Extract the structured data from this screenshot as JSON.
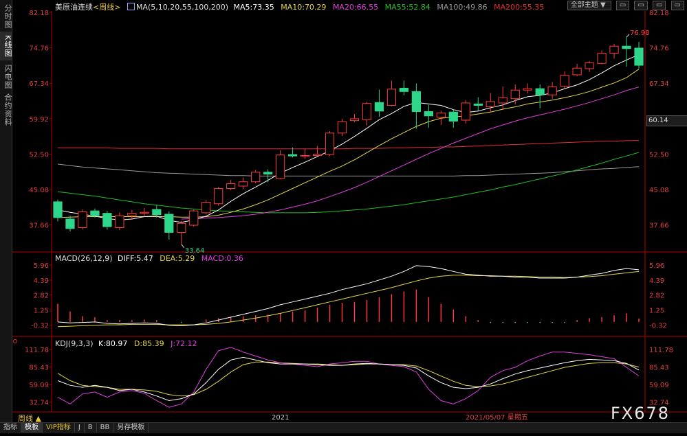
{
  "leftbar": [
    {
      "label": "分时图",
      "active": false
    },
    {
      "label": "K线图",
      "active": true
    },
    {
      "label": "闪电图",
      "active": false
    },
    {
      "label": "合约资料",
      "active": false
    }
  ],
  "header": {
    "instrument": "美原油连续",
    "period_tag": "<周线>",
    "ma_label": "MA(5,10,20,55,100,200)",
    "ma5": "MA5:73.35",
    "ma10": "MA10:70.29",
    "ma20": "MA20:66.55",
    "ma55": "MA55:52.84",
    "ma100": "MA100:49.86",
    "ma200": "MA200:55.35"
  },
  "toolbar": {
    "theme_select": "全部主题",
    "theme_arrow": "▼",
    "btn1": "▭",
    "btn2": "▭",
    "btn3": "▭",
    "btn4": "▭"
  },
  "colors": {
    "up": "#ff3c3c",
    "down": "#2ed68a",
    "ma5": "#ffffff",
    "ma10": "#e8d84a",
    "ma20": "#e040e0",
    "ma55": "#22c022",
    "ma100": "#9a9a9a",
    "ma200": "#e03030",
    "axis": "#b40000"
  },
  "chart_data": [
    {
      "type": "candlestick",
      "title": "美原油连续<周线>",
      "ylim": [
        33.0,
        82.18
      ],
      "y_ticks": [
        "82.18",
        "74.76",
        "67.34",
        "59.92",
        "52.50",
        "45.08",
        "37.66"
      ],
      "annotations": {
        "high": "76.98",
        "low": "33.64",
        "current_price": "60.14"
      },
      "candles": [
        {
          "o": 42.5,
          "h": 43.0,
          "c": 39.2,
          "l": 38.4
        },
        {
          "o": 38.9,
          "h": 39.6,
          "c": 36.9,
          "l": 36.3
        },
        {
          "o": 37.1,
          "h": 40.9,
          "c": 40.4,
          "l": 36.7
        },
        {
          "o": 40.6,
          "h": 41.1,
          "c": 39.6,
          "l": 39.2
        },
        {
          "o": 40.1,
          "h": 40.6,
          "c": 37.3,
          "l": 36.7
        },
        {
          "o": 37.1,
          "h": 40.3,
          "c": 39.6,
          "l": 36.6
        },
        {
          "o": 39.6,
          "h": 40.8,
          "c": 40.1,
          "l": 38.9
        },
        {
          "o": 40.1,
          "h": 41.2,
          "c": 40.3,
          "l": 39.5
        },
        {
          "o": 40.9,
          "h": 41.9,
          "c": 39.8,
          "l": 39.2
        },
        {
          "o": 39.9,
          "h": 40.5,
          "c": 36.1,
          "l": 34.6
        },
        {
          "o": 36.1,
          "h": 38.5,
          "c": 38.0,
          "l": 33.6
        },
        {
          "o": 37.6,
          "h": 40.9,
          "c": 40.6,
          "l": 37.3
        },
        {
          "o": 40.2,
          "h": 42.9,
          "c": 42.4,
          "l": 39.9
        },
        {
          "o": 42.1,
          "h": 45.6,
          "c": 45.3,
          "l": 41.7
        },
        {
          "o": 45.3,
          "h": 47.1,
          "c": 46.3,
          "l": 44.9
        },
        {
          "o": 45.8,
          "h": 47.6,
          "c": 46.7,
          "l": 45.2
        },
        {
          "o": 46.7,
          "h": 49.2,
          "c": 48.7,
          "l": 46.4
        },
        {
          "o": 48.7,
          "h": 49.3,
          "c": 48.3,
          "l": 46.6
        },
        {
          "o": 47.4,
          "h": 53.3,
          "c": 52.3,
          "l": 47.2
        },
        {
          "o": 52.4,
          "h": 53.9,
          "c": 52.1,
          "l": 51.8
        },
        {
          "o": 52.0,
          "h": 53.6,
          "c": 52.2,
          "l": 51.5
        },
        {
          "o": 52.2,
          "h": 54.2,
          "c": 52.5,
          "l": 52.0
        },
        {
          "o": 52.4,
          "h": 57.3,
          "c": 56.9,
          "l": 52.1
        },
        {
          "o": 56.9,
          "h": 59.9,
          "c": 59.3,
          "l": 56.3
        },
        {
          "o": 59.5,
          "h": 60.9,
          "c": 59.9,
          "l": 59.2
        },
        {
          "o": 59.7,
          "h": 63.4,
          "c": 63.1,
          "l": 58.5
        },
        {
          "o": 63.3,
          "h": 66.0,
          "c": 61.5,
          "l": 60.3
        },
        {
          "o": 62.7,
          "h": 67.9,
          "c": 66.1,
          "l": 62.5
        },
        {
          "o": 66.3,
          "h": 67.9,
          "c": 65.6,
          "l": 64.8
        },
        {
          "o": 65.6,
          "h": 67.3,
          "c": 61.4,
          "l": 57.8
        },
        {
          "o": 61.4,
          "h": 62.8,
          "c": 60.5,
          "l": 58.0
        },
        {
          "o": 60.2,
          "h": 61.6,
          "c": 61.1,
          "l": 58.6
        },
        {
          "o": 61.3,
          "h": 61.9,
          "c": 59.4,
          "l": 58.0
        },
        {
          "o": 59.6,
          "h": 63.8,
          "c": 63.2,
          "l": 58.9
        },
        {
          "o": 63.0,
          "h": 64.4,
          "c": 62.7,
          "l": 61.6
        },
        {
          "o": 62.4,
          "h": 65.3,
          "c": 63.5,
          "l": 61.2
        },
        {
          "o": 63.2,
          "h": 66.7,
          "c": 64.3,
          "l": 61.9
        },
        {
          "o": 64.1,
          "h": 67.1,
          "c": 65.9,
          "l": 62.9
        },
        {
          "o": 65.9,
          "h": 67.3,
          "c": 66.2,
          "l": 65.2
        },
        {
          "o": 66.2,
          "h": 67.1,
          "c": 64.9,
          "l": 62.1
        },
        {
          "o": 64.9,
          "h": 67.6,
          "c": 66.6,
          "l": 64.1
        },
        {
          "o": 66.7,
          "h": 69.8,
          "c": 69.0,
          "l": 66.2
        },
        {
          "o": 69.1,
          "h": 71.4,
          "c": 70.5,
          "l": 68.8
        },
        {
          "o": 70.4,
          "h": 72.0,
          "c": 71.6,
          "l": 69.7
        },
        {
          "o": 71.5,
          "h": 74.2,
          "c": 73.6,
          "l": 71.3
        },
        {
          "o": 73.6,
          "h": 75.6,
          "c": 75.1,
          "l": 72.5
        },
        {
          "o": 75.1,
          "h": 77.0,
          "c": 74.6,
          "l": 70.8
        },
        {
          "o": 74.7,
          "h": 76.0,
          "c": 71.1,
          "l": 70.4
        }
      ],
      "ma5": [
        40.8,
        40.3,
        39.9,
        39.5,
        39.0,
        38.7,
        38.9,
        39.4,
        39.5,
        38.6,
        38.2,
        38.7,
        39.5,
        40.8,
        42.6,
        44.2,
        45.6,
        47.0,
        48.5,
        49.7,
        50.8,
        52.0,
        53.2,
        54.6,
        56.2,
        57.9,
        59.7,
        61.0,
        62.5,
        63.3,
        63.0,
        62.7,
        61.8,
        61.2,
        61.5,
        62.2,
        62.8,
        63.7,
        64.5,
        64.8,
        65.3,
        66.2,
        67.0,
        68.1,
        69.5,
        71.0,
        72.2,
        73.35
      ],
      "ma10": [
        39.2,
        39.3,
        39.4,
        39.4,
        39.4,
        39.4,
        39.4,
        39.4,
        39.4,
        39.4,
        39.3,
        39.3,
        39.4,
        39.7,
        40.3,
        41.0,
        41.9,
        42.9,
        44.1,
        45.3,
        46.5,
        47.7,
        48.9,
        50.0,
        51.3,
        52.8,
        54.3,
        55.7,
        57.0,
        58.3,
        59.3,
        60.0,
        60.3,
        60.5,
        60.9,
        61.3,
        61.9,
        62.4,
        63.0,
        63.4,
        63.8,
        64.3,
        64.9,
        65.6,
        66.5,
        67.4,
        68.5,
        70.29
      ],
      "ma20": [
        null,
        null,
        null,
        null,
        null,
        null,
        null,
        null,
        null,
        null,
        38.9,
        39.0,
        39.1,
        39.2,
        39.4,
        39.6,
        39.9,
        40.3,
        40.8,
        41.4,
        42.0,
        42.7,
        43.6,
        44.5,
        45.5,
        46.6,
        47.8,
        49.0,
        50.2,
        51.4,
        52.6,
        53.7,
        54.8,
        55.8,
        56.8,
        57.8,
        58.6,
        59.4,
        60.1,
        60.7,
        61.3,
        61.9,
        62.6,
        63.3,
        64.1,
        64.9,
        65.8,
        66.55
      ],
      "ma55": [
        44.6,
        44.3,
        44.0,
        43.7,
        43.3,
        42.9,
        42.5,
        42.1,
        41.8,
        41.5,
        41.2,
        41.0,
        40.8,
        40.6,
        40.5,
        40.4,
        40.3,
        40.2,
        40.2,
        40.2,
        40.2,
        40.3,
        40.4,
        40.6,
        40.8,
        41.0,
        41.3,
        41.6,
        41.9,
        42.3,
        42.7,
        43.1,
        43.5,
        44.0,
        44.5,
        45.0,
        45.6,
        46.1,
        46.7,
        47.3,
        47.9,
        48.5,
        49.2,
        49.9,
        50.6,
        51.4,
        52.1,
        52.84
      ],
      "ma100": [
        50.4,
        50.1,
        49.8,
        49.6,
        49.4,
        49.2,
        49.0,
        48.8,
        48.6,
        48.5,
        48.4,
        48.3,
        48.2,
        48.1,
        48.0,
        48.0,
        47.9,
        47.9,
        47.9,
        47.9,
        47.9,
        47.9,
        47.9,
        47.9,
        47.9,
        47.9,
        47.9,
        47.9,
        47.9,
        47.9,
        47.9,
        47.9,
        47.9,
        48.0,
        48.0,
        48.1,
        48.2,
        48.3,
        48.4,
        48.5,
        48.6,
        48.8,
        49.0,
        49.2,
        49.4,
        49.5,
        49.7,
        49.86
      ],
      "ma200": [
        53.8,
        53.8,
        53.8,
        53.8,
        53.8,
        53.7,
        53.7,
        53.7,
        53.7,
        53.6,
        53.6,
        53.6,
        53.6,
        53.6,
        53.6,
        53.6,
        53.6,
        53.6,
        53.6,
        53.6,
        53.6,
        53.6,
        53.6,
        53.6,
        53.7,
        53.7,
        53.7,
        53.8,
        53.8,
        53.9,
        53.9,
        54.0,
        54.0,
        54.1,
        54.2,
        54.3,
        54.4,
        54.5,
        54.6,
        54.7,
        54.8,
        54.9,
        55.0,
        55.1,
        55.2,
        55.2,
        55.3,
        55.35
      ]
    },
    {
      "type": "macd",
      "legend": {
        "label": "MACD(26,12,9)",
        "diff": "DIFF:5.47",
        "dea": "DEA:5.29",
        "macd": "MACD:0.36"
      },
      "ylim": [
        -0.8,
        6.4
      ],
      "y_ticks": [
        "5.96",
        "4.39",
        "2.82",
        "1.25",
        "-0.32"
      ],
      "diff": [
        0.0,
        -0.1,
        -0.05,
        0.0,
        -0.15,
        -0.2,
        -0.15,
        -0.1,
        -0.15,
        -0.35,
        -0.4,
        -0.3,
        -0.1,
        0.2,
        0.5,
        0.8,
        1.1,
        1.4,
        1.8,
        2.1,
        2.4,
        2.7,
        3.0,
        3.4,
        3.7,
        4.0,
        4.4,
        4.8,
        5.3,
        5.9,
        5.8,
        5.6,
        5.3,
        5.0,
        4.9,
        4.8,
        4.8,
        4.7,
        4.7,
        4.6,
        4.6,
        4.6,
        4.7,
        4.9,
        5.1,
        5.4,
        5.6,
        5.47
      ],
      "dea": [
        -0.5,
        -0.45,
        -0.4,
        -0.35,
        -0.3,
        -0.3,
        -0.25,
        -0.25,
        -0.25,
        -0.3,
        -0.3,
        -0.3,
        -0.25,
        -0.15,
        0.0,
        0.2,
        0.4,
        0.65,
        0.9,
        1.2,
        1.5,
        1.8,
        2.1,
        2.4,
        2.7,
        3.0,
        3.3,
        3.6,
        3.95,
        4.3,
        4.6,
        4.8,
        4.9,
        4.9,
        4.85,
        4.85,
        4.8,
        4.8,
        4.75,
        4.7,
        4.7,
        4.65,
        4.7,
        4.75,
        4.85,
        5.0,
        5.15,
        5.29
      ],
      "bars": [
        1.9,
        1.1,
        0.6,
        0.5,
        0.2,
        0.2,
        0.2,
        0.25,
        0.2,
        0.0,
        -0.1,
        0.0,
        0.25,
        0.4,
        0.5,
        0.6,
        0.7,
        0.75,
        0.9,
        1.1,
        1.2,
        1.5,
        1.8,
        2.0,
        2.1,
        2.3,
        2.6,
        2.9,
        3.2,
        3.4,
        2.6,
        1.9,
        1.3,
        0.6,
        0.2,
        -0.1,
        -0.1,
        -0.1,
        -0.1,
        -0.1,
        -0.1,
        -0.1,
        0.2,
        0.4,
        0.5,
        0.7,
        0.9,
        0.36
      ]
    },
    {
      "type": "kdj",
      "legend": {
        "label": "KDJ(9,3,3)",
        "k": "K:80.97",
        "d": "D:85.39",
        "j": "J:72.12"
      },
      "ylim": [
        20,
        118
      ],
      "y_ticks": [
        "111.78",
        "85.43",
        "59.09",
        "32.74"
      ],
      "k": [
        65,
        58,
        55,
        58,
        55,
        50,
        52,
        48,
        42,
        35,
        38,
        45,
        62,
        82,
        96,
        100,
        96,
        92,
        90,
        90,
        90,
        89,
        88,
        88,
        90,
        91,
        90,
        89,
        88,
        84,
        72,
        62,
        55,
        53,
        55,
        60,
        68,
        75,
        80,
        84,
        88,
        92,
        95,
        97,
        96,
        95,
        91,
        80.97
      ],
      "d": [
        76,
        65,
        58,
        56,
        55,
        52,
        52,
        51,
        49,
        44,
        42,
        44,
        52,
        64,
        78,
        89,
        93,
        93,
        92,
        91,
        90,
        90,
        89,
        88,
        89,
        90,
        90,
        89,
        89,
        87,
        80,
        72,
        64,
        58,
        56,
        57,
        60,
        65,
        70,
        75,
        80,
        85,
        88,
        91,
        92,
        92,
        90,
        85.39
      ],
      "j": [
        40,
        30,
        45,
        48,
        40,
        48,
        50,
        46,
        35,
        25,
        30,
        48,
        82,
        110,
        115,
        108,
        102,
        96,
        92,
        90,
        88,
        86,
        90,
        92,
        94,
        94,
        90,
        88,
        86,
        78,
        52,
        35,
        30,
        38,
        50,
        70,
        80,
        85,
        95,
        102,
        108,
        108,
        106,
        104,
        101,
        98,
        85,
        72.12
      ]
    }
  ],
  "x_axis": {
    "year_label": "2021",
    "cursor_date": "2021/05/07 星期五"
  },
  "bottombar": {
    "period": "周线 ▲",
    "tabs": [
      {
        "label": "指标",
        "selected": false
      },
      {
        "label": "模板",
        "selected": true
      },
      {
        "label": "VIP指标",
        "selected": false,
        "vip": true
      },
      {
        "label": "J",
        "selected": false
      },
      {
        "label": "B",
        "selected": false
      },
      {
        "label": "BB",
        "selected": false
      },
      {
        "label": "另存模板",
        "selected": false
      }
    ]
  },
  "watermark": "FX678"
}
